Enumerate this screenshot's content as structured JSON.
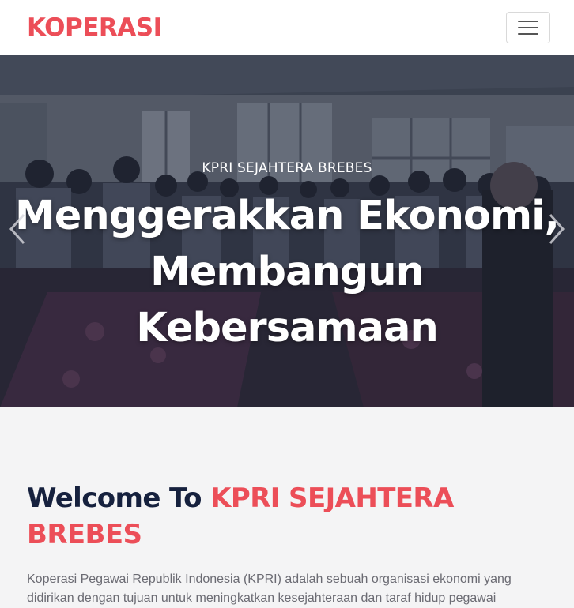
{
  "colors": {
    "brand": "#ec4e58",
    "heading_dark": "#16213e",
    "body_text": "#6b6b73",
    "section_bg": "#f4f4f5"
  },
  "navbar": {
    "brand": "KOPERASI",
    "toggle_icon": "hamburger-menu-icon"
  },
  "hero": {
    "subtitle": "KPRI SEJAHTERA BREBES",
    "title_line1": "Menggerakkan Ekonomi,",
    "title_line2": "Membangun Kebersamaan",
    "prev_icon": "chevron-left-icon",
    "next_icon": "chevron-right-icon"
  },
  "welcome": {
    "title_prefix": "Welcome To ",
    "title_highlight": "KPRI SEJAHTERA BREBES",
    "paragraph": "Koperasi Pegawai Republik Indonesia (KPRI) adalah sebuah organisasi ekonomi yang didirikan dengan tujuan untuk meningkatkan kesejahteraan dan taraf hidup pegawai"
  }
}
